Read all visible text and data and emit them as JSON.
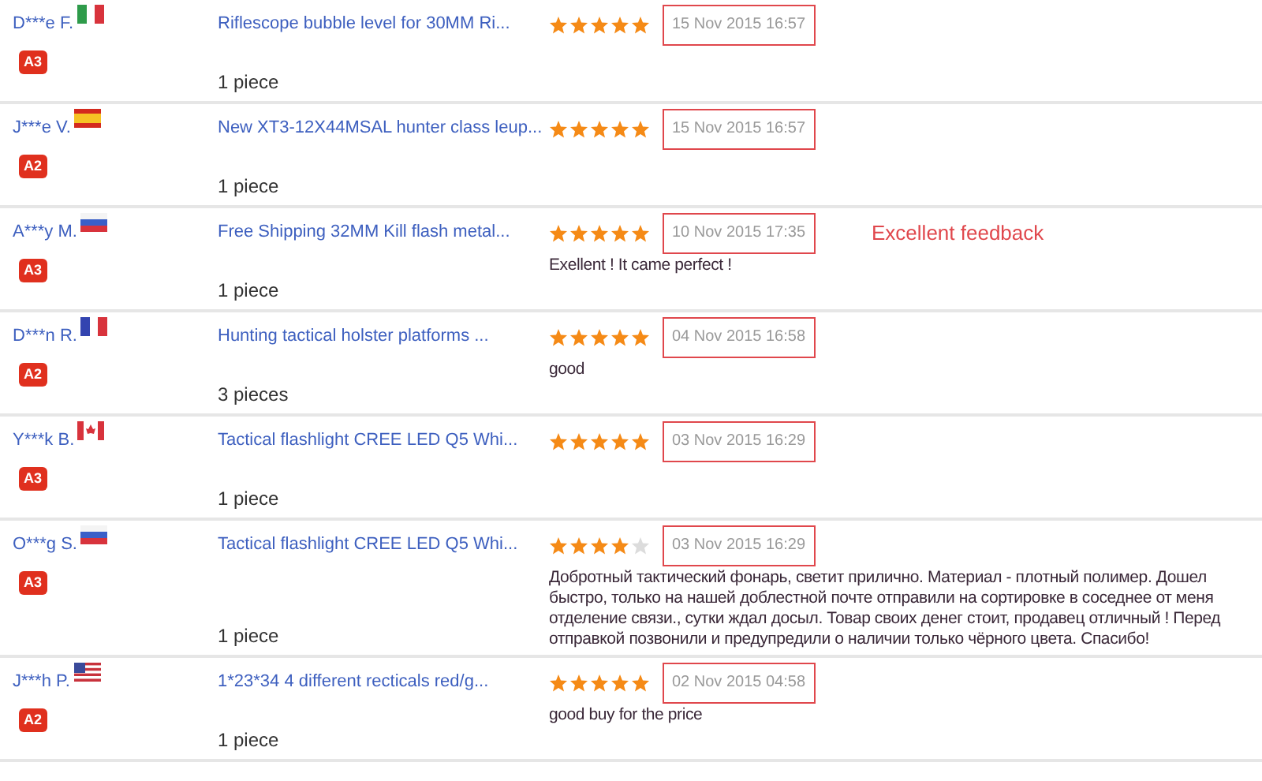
{
  "reviews": [
    {
      "buyer": "D***e F.",
      "flag": {
        "kind": "italy"
      },
      "level_badge": "A3",
      "product": "Riflescope bubble level for 30MM Ri...",
      "quantity": "1 piece",
      "stars": 5,
      "date": "15 Nov 2015 16:57"
    },
    {
      "buyer": "J***e V.",
      "flag": {
        "kind": "spain"
      },
      "level_badge": "A2",
      "product": "New XT3-12X44MSAL hunter class leup...",
      "quantity": "1 piece",
      "stars": 5,
      "date": "15 Nov 2015 16:57"
    },
    {
      "buyer": "A***y M.",
      "flag": {
        "kind": "russia"
      },
      "level_badge": "A3",
      "product": "Free Shipping 32MM Kill flash metal...",
      "quantity": "1 piece",
      "stars": 5,
      "date": "10 Nov 2015 17:35",
      "comment": "Exellent ! It came perfect !",
      "note": "Excellent feedback"
    },
    {
      "buyer": "D***n R.",
      "flag": {
        "kind": "france"
      },
      "level_badge": "A2",
      "product": "Hunting tactical holster platforms ...",
      "quantity": "3 pieces",
      "stars": 5,
      "date": "04 Nov 2015 16:58",
      "comment": "good"
    },
    {
      "buyer": "Y***k B.",
      "flag": {
        "kind": "canada"
      },
      "level_badge": "A3",
      "product": "Tactical flashlight CREE LED Q5 Whi...",
      "quantity": "1 piece",
      "stars": 5,
      "date": "03 Nov 2015 16:29"
    },
    {
      "buyer": "O***g S.",
      "flag": {
        "kind": "russia"
      },
      "level_badge": "A3",
      "product": "Tactical flashlight CREE LED Q5 Whi...",
      "quantity": "1 piece",
      "stars": 4,
      "date": "03 Nov 2015 16:29",
      "comment": "Добротный тактический фонарь, светит прилично. Материал - плотный полимер. Дошел быстро, только на нашей доблестной почте отправили на сортировке в соседнее от меня отделение связи., сутки ждал досыл. Товар своих денег стоит, продавец отличный ! Перед отправкой позвонили и предупредили о наличии только чёрного цвета. Спасибо!"
    },
    {
      "buyer": "J***h P.",
      "flag": {
        "kind": "usa"
      },
      "level_badge": "A2",
      "product": "1*23*34 4 different recticals red/g...",
      "quantity": "1 piece",
      "stars": 5,
      "date": "02 Nov 2015 04:58",
      "comment": "good buy for the price"
    }
  ]
}
